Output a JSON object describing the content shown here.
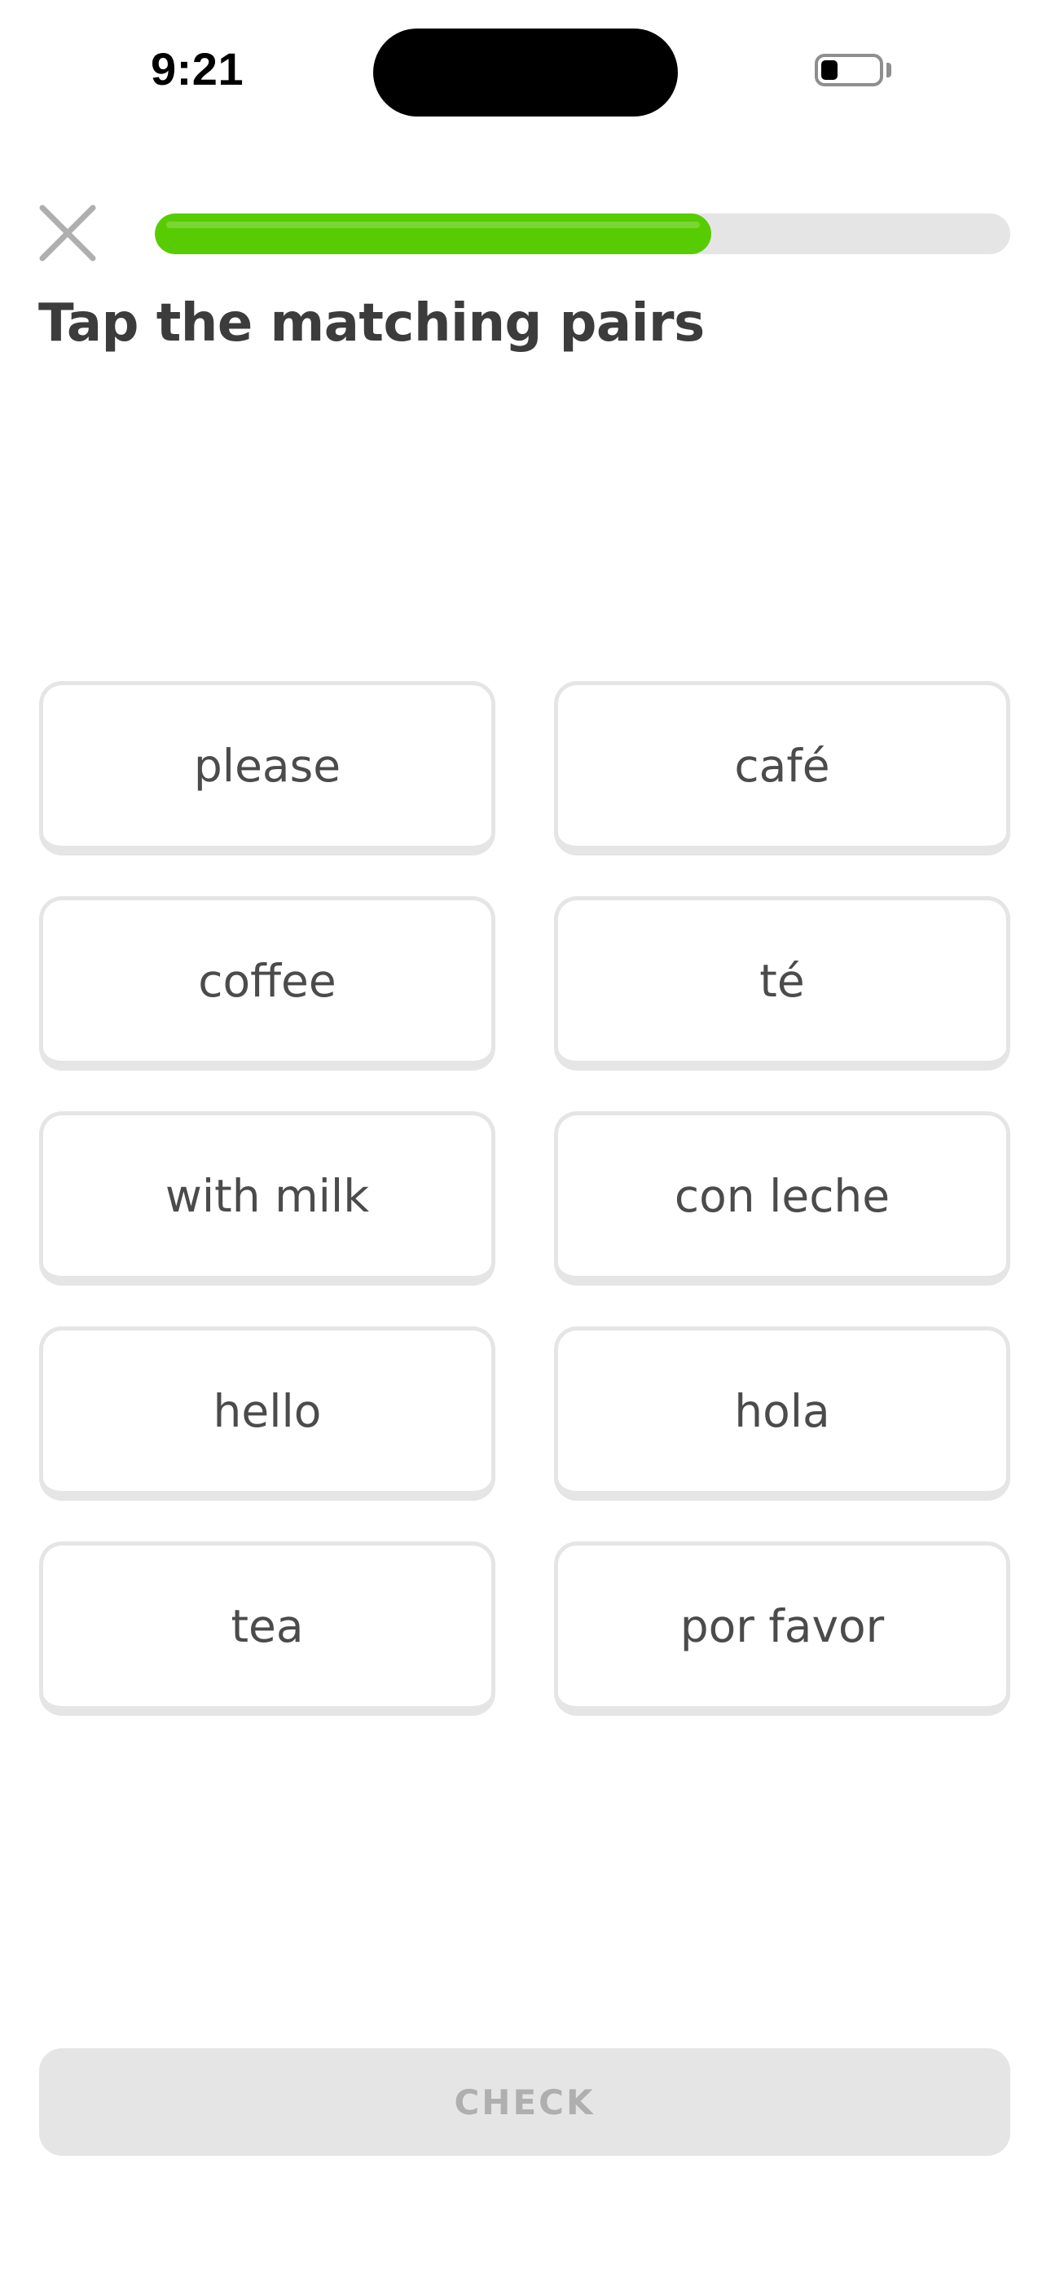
{
  "status_bar": {
    "time": "9:21",
    "battery_level": 0.3
  },
  "header": {
    "close_icon": "close-x-icon",
    "progress": 0.65,
    "progress_color": "#58cc02"
  },
  "prompt": {
    "title": "Tap the matching pairs"
  },
  "tiles": {
    "left": [
      "please",
      "coffee",
      "with milk",
      "hello",
      "tea"
    ],
    "right": [
      "café",
      "té",
      "con leche",
      "hola",
      "por favor"
    ]
  },
  "footer": {
    "check_label": "CHECK"
  }
}
